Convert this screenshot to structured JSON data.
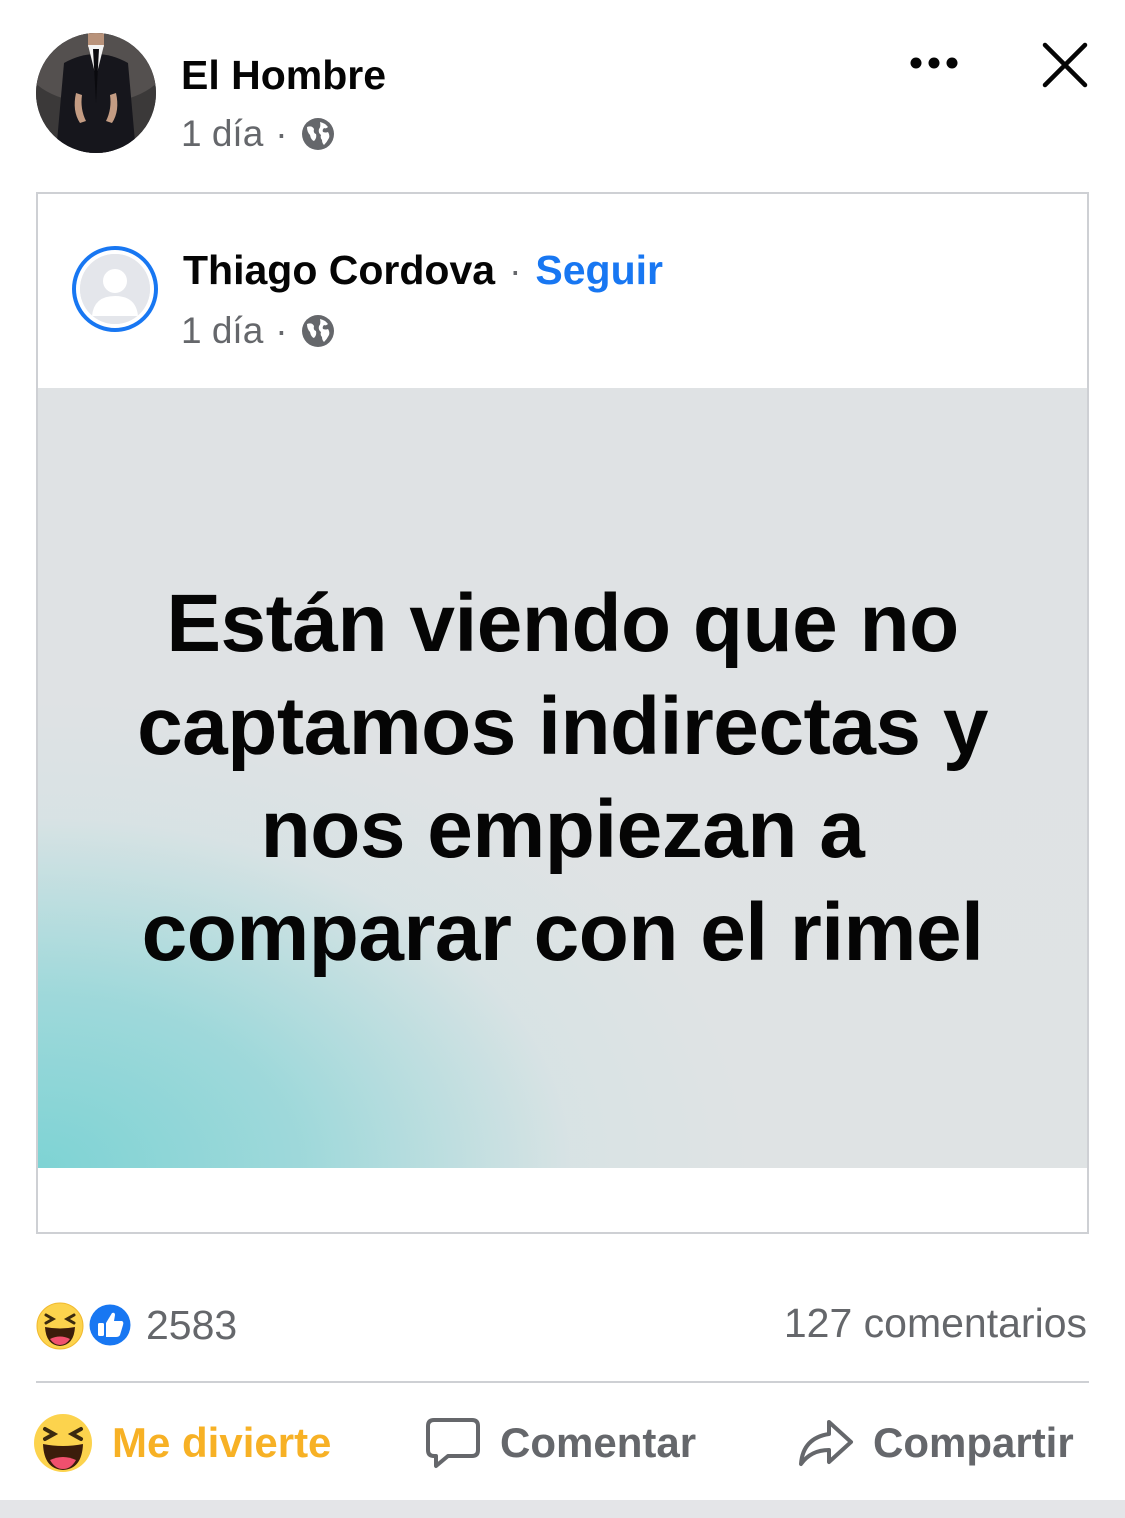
{
  "post": {
    "author": "El Hombre",
    "time": "1 día",
    "separator": "·"
  },
  "shared": {
    "author": "Thiago Cordova",
    "separator": "·",
    "follow_label": "Seguir",
    "time": "1 día",
    "image_text": "Están viendo que no captamos indirectas y nos empiezan a comparar con el rimel"
  },
  "stats": {
    "reaction_count": "2583",
    "comments": "127 comentarios"
  },
  "actions": {
    "react_label": "Me divierte",
    "comment_label": "Comentar",
    "share_label": "Compartir"
  },
  "icons": {
    "more": "more-horizontal-icon",
    "close": "close-icon",
    "privacy": "globe-icon",
    "haha": "haha-emoji-icon",
    "like": "like-thumb-icon",
    "comment": "comment-bubble-icon",
    "share": "share-arrow-icon"
  },
  "colors": {
    "link_blue": "#1877f2",
    "haha_yellow": "#f7b125",
    "secondary_text": "#65676b"
  }
}
